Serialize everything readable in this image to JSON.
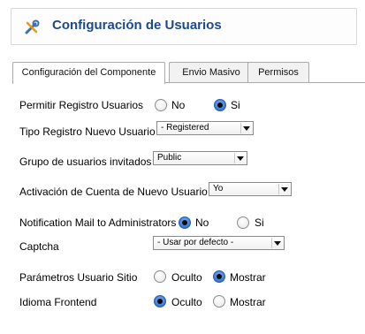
{
  "header": {
    "title": "Configuración de Usuarios",
    "icon": "tools-icon"
  },
  "tabs": [
    {
      "label": "Configuración del Componente",
      "active": true
    },
    {
      "label": "Envio Masivo",
      "active": false
    },
    {
      "label": "Permisos",
      "active": false
    }
  ],
  "form": {
    "allow_registration": {
      "label": "Permitir Registro Usuarios",
      "options": [
        "No",
        "Si"
      ],
      "selected": "Si"
    },
    "new_user_type": {
      "label": "Tipo Registro Nuevo Usuario",
      "value": "- Registered"
    },
    "guest_group": {
      "label": "Grupo de usuarios invitados",
      "value": "Public"
    },
    "account_activation": {
      "label": "Activación de Cuenta de Nuevo Usuario",
      "value": "Yo"
    },
    "notification_mail": {
      "label": "Notification Mail to Administrators",
      "options": [
        "No",
        "Si"
      ],
      "selected": "No"
    },
    "captcha": {
      "label": "Captcha",
      "value": "- Usar por defecto -"
    },
    "site_user_params": {
      "label": "Parámetros Usuario Sitio",
      "options": [
        "Oculto",
        "Mostrar"
      ],
      "selected": "Mostrar"
    },
    "frontend_language": {
      "label": "Idioma Frontend",
      "options": [
        "Oculto",
        "Mostrar"
      ],
      "selected": "Oculto"
    }
  }
}
